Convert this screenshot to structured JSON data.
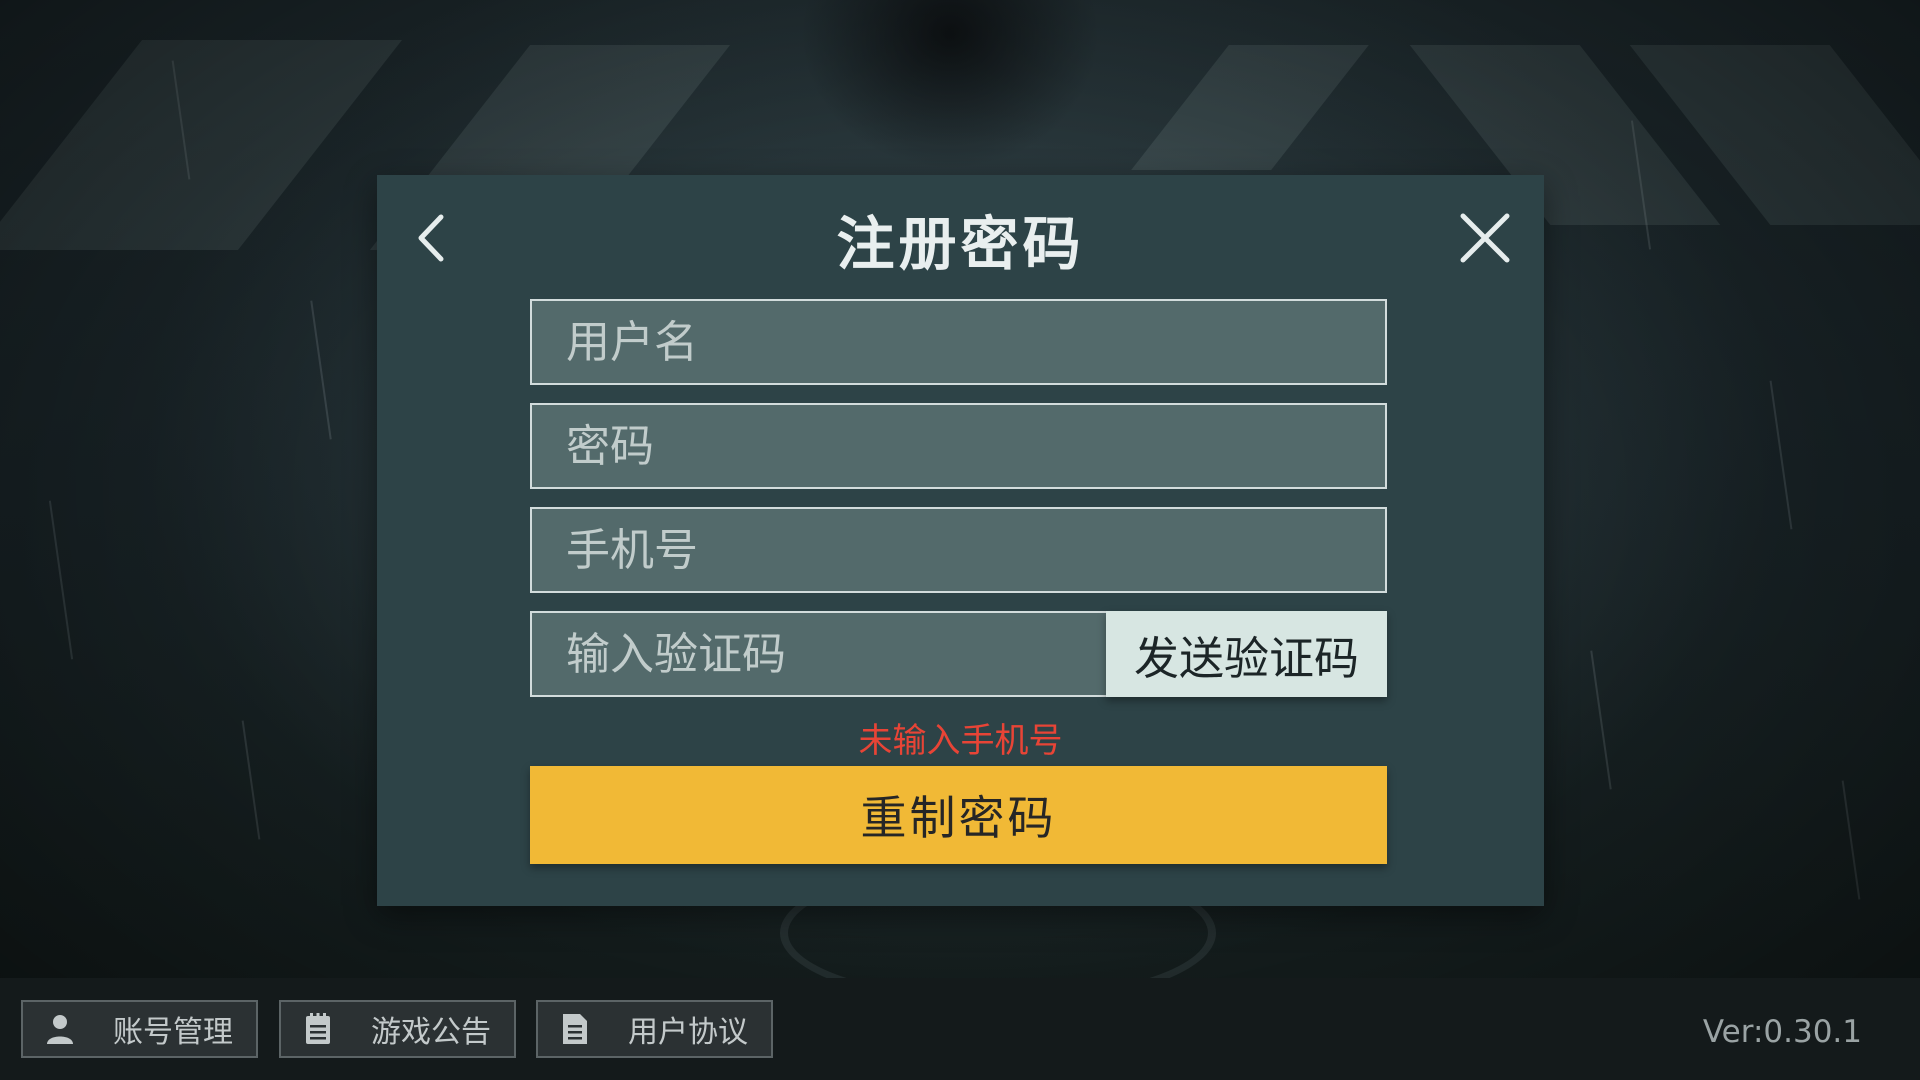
{
  "dialog": {
    "title": "注册密码",
    "back_icon": "chevron-left-icon",
    "close_icon": "close-icon"
  },
  "form": {
    "username_placeholder": "用户名",
    "password_placeholder": "密码",
    "phone_placeholder": "手机号",
    "code_placeholder": "输入验证码",
    "send_code_label": "发送验证码",
    "error_message": "未输入手机号",
    "submit_label": "重制密码"
  },
  "bottom_bar": {
    "buttons": [
      {
        "label": "账号管理",
        "icon": "user-icon"
      },
      {
        "label": "游戏公告",
        "icon": "notepad-icon"
      },
      {
        "label": "用户协议",
        "icon": "document-icon"
      }
    ],
    "version": "Ver:0.30.1"
  },
  "colors": {
    "dialog_bg": "#2d4347",
    "field_bg": "#536a6b",
    "accent": "#f1b936",
    "error": "#e84436",
    "send_code_bg": "#d7e6e2"
  }
}
